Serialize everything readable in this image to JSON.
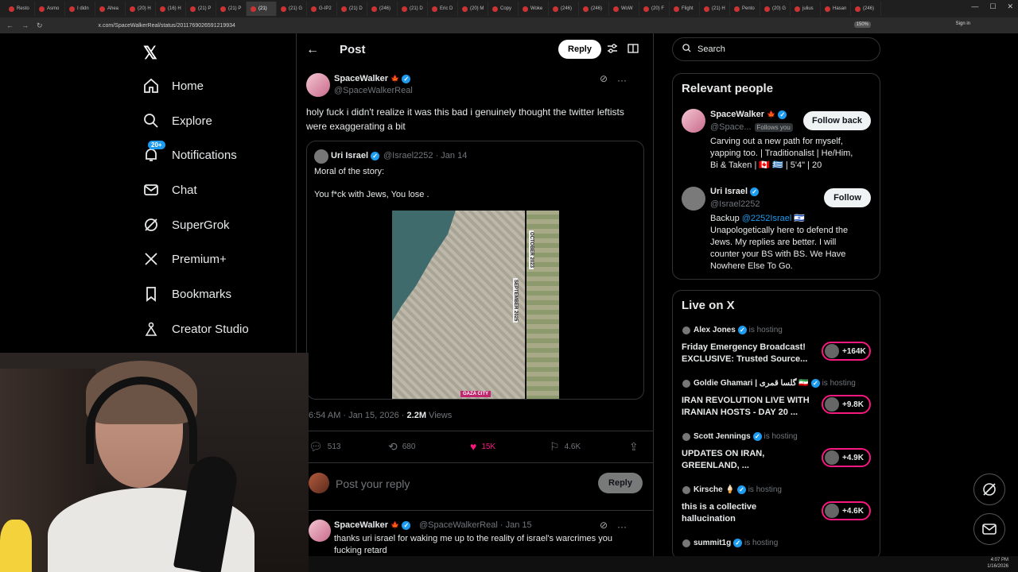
{
  "browser": {
    "tabs": [
      "Resto",
      "Asmo",
      "I didn",
      "Ahea",
      "(20) H",
      "(16) H",
      "(21) P",
      "(21) P",
      "(21)",
      "(21) G",
      "G-IP2",
      "(21) D",
      "(246)",
      "(21) D",
      "Eric D",
      "(20) M",
      "Copy",
      "Woke",
      "(246)",
      "(246)",
      "WoW",
      "(20) F",
      "Flight",
      "(21) H",
      "Pento",
      "(20) G",
      "julius",
      "Hasan",
      "(246)"
    ],
    "url": "x.com/SpaceWalkerReal/status/2011769026591219934",
    "zoom": "150%",
    "sign_in": "Sign in"
  },
  "nav": {
    "items": [
      {
        "label": "Home",
        "icon": "home-icon"
      },
      {
        "label": "Explore",
        "icon": "search-icon"
      },
      {
        "label": "Notifications",
        "icon": "bell-icon",
        "badge": "20+"
      },
      {
        "label": "Chat",
        "icon": "mail-icon"
      },
      {
        "label": "SuperGrok",
        "icon": "grok-icon"
      },
      {
        "label": "Premium+",
        "icon": "x-icon"
      },
      {
        "label": "Bookmarks",
        "icon": "bookmark-icon"
      },
      {
        "label": "Creator Studio",
        "icon": "creator-icon"
      }
    ]
  },
  "header": {
    "title": "Post",
    "reply_label": "Reply"
  },
  "tweet": {
    "name": "SpaceWalker",
    "handle": "@SpaceWalkerReal",
    "text": "holy fuck i didn't realize it was this bad i genuinely thought the twitter leftists were exaggerating a bit",
    "quote": {
      "name": "Uri Israel",
      "handle": "@Israel2252 · Jan 14",
      "line1": "Moral of the story:",
      "line2": "You f*ck with Jews, You lose .",
      "image_labels": {
        "top": "OCTOBER 2023",
        "bottom": "SEPTEMBER 2025",
        "place": "GAZA CITY"
      }
    },
    "time": "6:54 AM · Jan 15, 2026 · ",
    "views": "2.2M",
    "views_label": " Views",
    "stats": {
      "replies": "513",
      "reposts": "680",
      "likes": "15K",
      "bookmarks": "4.6K"
    }
  },
  "reply_box": {
    "placeholder": "Post your reply",
    "button": "Reply"
  },
  "reply_tweet": {
    "name": "SpaceWalker",
    "handle": "@SpaceWalkerReal · Jan 15",
    "text": "thanks uri israel for waking me up to the reality of israel's warcrimes you fucking retard"
  },
  "search": {
    "placeholder": "Search"
  },
  "relevant": {
    "title": "Relevant people",
    "people": [
      {
        "name": "SpaceWalker",
        "handle": "@Space...",
        "follows_you": "Follows you",
        "button": "Follow back",
        "bio": "Carving out a new path for myself, yapping too. | Traditionalist | He/Him, Bi & Taken | 🇨🇦 🇬🇷 | 5'4\" | 20"
      },
      {
        "name": "Uri Israel",
        "handle": "@Israel2252",
        "button": "Follow",
        "bio_prefix": "Backup ",
        "bio_link": "@2252Israel",
        "bio_rest": " 🇮🇱 Unapologetically here to defend the Jews. My replies are better. I will counter your BS with BS. We Have Nowhere Else To Go."
      }
    ]
  },
  "live": {
    "title": "Live on X",
    "hosting_label": "is hosting",
    "items": [
      {
        "host": "Alex Jones",
        "title": "Friday Emergency Broadcast! EXCLUSIVE: Trusted Source...",
        "count": "+164K"
      },
      {
        "host": "Goldie Ghamari | گلسا قمری 🇮🇷",
        "title": "IRAN REVOLUTION LIVE WITH IRANIAN HOSTS - DAY 20 ...",
        "count": "+9.8K"
      },
      {
        "host": "Scott Jennings",
        "title": "UPDATES ON IRAN, GREENLAND, ...",
        "count": "+4.9K"
      },
      {
        "host": "Kirsche 🍦",
        "title": "this is a collective hallucination",
        "count": "+4.6K"
      },
      {
        "host": "summit1g",
        "title": "",
        "count": ""
      }
    ]
  },
  "clock": {
    "time": "4:07 PM",
    "date": "1/16/2026"
  }
}
